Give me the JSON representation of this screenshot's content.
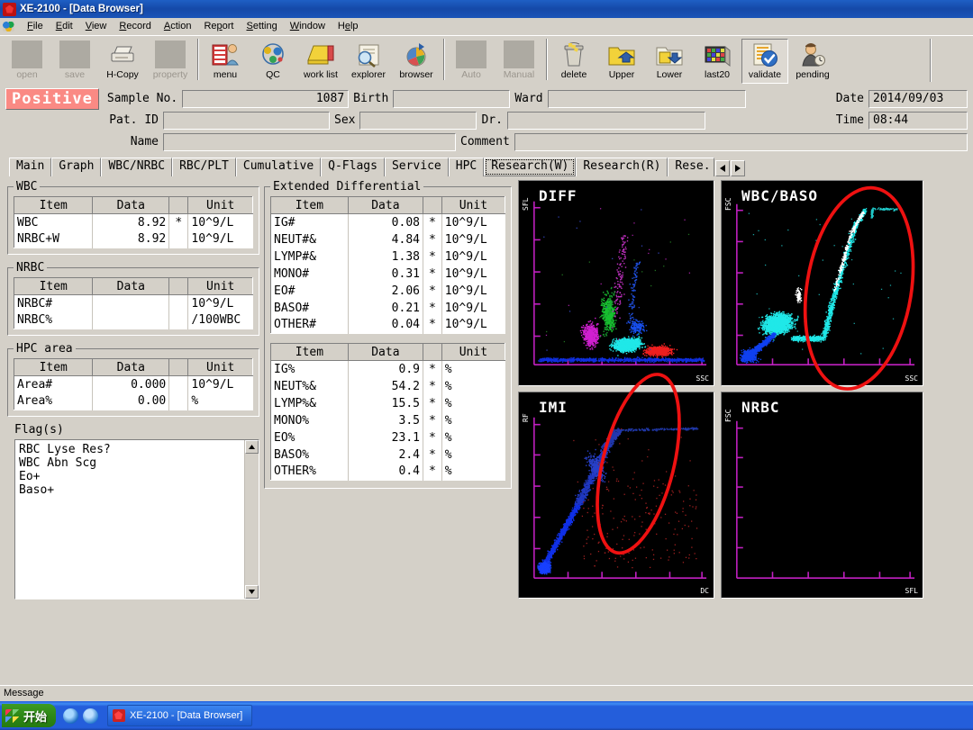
{
  "window": {
    "title": "XE-2100 - [Data Browser]",
    "app_icon": "app-icon"
  },
  "menubar": {
    "items": [
      {
        "label": "File"
      },
      {
        "label": "Edit"
      },
      {
        "label": "View"
      },
      {
        "label": "Record"
      },
      {
        "label": "Action"
      },
      {
        "label": "Report"
      },
      {
        "label": "Setting"
      },
      {
        "label": "Window"
      },
      {
        "label": "Help"
      }
    ]
  },
  "toolbar": {
    "buttons": [
      {
        "label": "open",
        "icon": "open-icon",
        "state": "disabled"
      },
      {
        "label": "save",
        "icon": "save-icon",
        "state": "disabled"
      },
      {
        "label": "H-Copy",
        "icon": "printer-icon",
        "state": "enabled"
      },
      {
        "label": "property",
        "icon": "property-icon",
        "state": "disabled"
      },
      {
        "label": "menu",
        "icon": "menu-icon",
        "state": "enabled"
      },
      {
        "label": "QC",
        "icon": "qc-icon",
        "state": "enabled"
      },
      {
        "label": "work list",
        "icon": "worklist-icon",
        "state": "enabled"
      },
      {
        "label": "explorer",
        "icon": "explorer-icon",
        "state": "enabled"
      },
      {
        "label": "browser",
        "icon": "browser-icon",
        "state": "enabled"
      },
      {
        "label": "Auto",
        "icon": "auto-icon",
        "state": "disabled"
      },
      {
        "label": "Manual",
        "icon": "manual-icon",
        "state": "disabled"
      },
      {
        "label": "delete",
        "icon": "trash-icon",
        "state": "enabled"
      },
      {
        "label": "Upper",
        "icon": "folder-up-icon",
        "state": "enabled"
      },
      {
        "label": "Lower",
        "icon": "folder-down-icon",
        "state": "enabled"
      },
      {
        "label": "last20",
        "icon": "last20-icon",
        "state": "enabled"
      },
      {
        "label": "validate",
        "icon": "validate-icon",
        "state": "pressed"
      },
      {
        "label": "pending",
        "icon": "pending-icon",
        "state": "enabled"
      }
    ]
  },
  "header": {
    "status_badge": "Positive",
    "status_badge_color": "#fa8a84",
    "fields": {
      "sample_no_label": "Sample No.",
      "sample_no_value": "1087",
      "birth_label": "Birth",
      "birth_value": "",
      "ward_label": "Ward",
      "ward_value": "",
      "date_label": "Date",
      "date_value": "2014/09/03",
      "patid_label": "Pat. ID",
      "patid_value": "",
      "sex_label": "Sex",
      "sex_value": "",
      "dr_label": "Dr.",
      "dr_value": "",
      "time_label": "Time",
      "time_value": "08:44",
      "name_label": "Name",
      "name_value": "",
      "comment_label": "Comment",
      "comment_value": ""
    }
  },
  "tabs": {
    "items": [
      {
        "label": "Main",
        "selected": false
      },
      {
        "label": "Graph",
        "selected": false
      },
      {
        "label": "WBC/NRBC",
        "selected": false
      },
      {
        "label": "RBC/PLT",
        "selected": false
      },
      {
        "label": "Cumulative",
        "selected": false
      },
      {
        "label": "Q-Flags",
        "selected": false
      },
      {
        "label": "Service",
        "selected": false
      },
      {
        "label": "HPC",
        "selected": false
      },
      {
        "label": "Research(W)",
        "selected": true
      },
      {
        "label": "Research(R)",
        "selected": false
      },
      {
        "label": "Rese.",
        "selected": false
      }
    ]
  },
  "panels": {
    "wbc": {
      "title": "WBC",
      "columns": [
        "Item",
        "Data",
        "",
        "Unit"
      ],
      "rows": [
        {
          "item": "WBC",
          "data": "8.92",
          "flag": "*",
          "unit": "10^9/L"
        },
        {
          "item": "NRBC+W",
          "data": "8.92",
          "flag": "",
          "unit": "10^9/L"
        }
      ]
    },
    "nrbc": {
      "title": "NRBC",
      "columns": [
        "Item",
        "Data",
        "",
        "Unit"
      ],
      "rows": [
        {
          "item": "NRBC#",
          "data": "",
          "flag": "",
          "unit": "10^9/L"
        },
        {
          "item": "NRBC%",
          "data": "",
          "flag": "",
          "unit": "/100WBC"
        }
      ]
    },
    "hpc": {
      "title": "HPC area",
      "columns": [
        "Item",
        "Data",
        "",
        "Unit"
      ],
      "rows": [
        {
          "item": "Area#",
          "data": "0.000",
          "flag": "",
          "unit": "10^9/L"
        },
        {
          "item": "Area%",
          "data": "0.00",
          "flag": "",
          "unit": "%"
        }
      ]
    },
    "flags": {
      "title": "Flag(s)",
      "items": [
        "RBC Lyse Res?",
        "WBC Abn Scg",
        "Eo+",
        "Baso+"
      ]
    },
    "extended_differential": {
      "title": "Extended Differential",
      "columns": [
        "Item",
        "Data",
        "",
        "Unit"
      ],
      "absolute_rows": [
        {
          "item": "IG#",
          "data": "0.08",
          "flag": "*",
          "unit": "10^9/L"
        },
        {
          "item": "NEUT#&",
          "data": "4.84",
          "flag": "*",
          "unit": "10^9/L"
        },
        {
          "item": "LYMP#&",
          "data": "1.38",
          "flag": "*",
          "unit": "10^9/L"
        },
        {
          "item": "MONO#",
          "data": "0.31",
          "flag": "*",
          "unit": "10^9/L"
        },
        {
          "item": "EO#",
          "data": "2.06",
          "flag": "*",
          "unit": "10^9/L"
        },
        {
          "item": "BASO#",
          "data": "0.21",
          "flag": "*",
          "unit": "10^9/L"
        },
        {
          "item": "OTHER#",
          "data": "0.04",
          "flag": "*",
          "unit": "10^9/L"
        }
      ],
      "percent_rows": [
        {
          "item": "IG%",
          "data": "0.9",
          "flag": "*",
          "unit": "%"
        },
        {
          "item": "NEUT%&",
          "data": "54.2",
          "flag": "*",
          "unit": "%"
        },
        {
          "item": "LYMP%&",
          "data": "15.5",
          "flag": "*",
          "unit": "%"
        },
        {
          "item": "MONO%",
          "data": "3.5",
          "flag": "*",
          "unit": "%"
        },
        {
          "item": "EO%",
          "data": "23.1",
          "flag": "*",
          "unit": "%"
        },
        {
          "item": "BASO%",
          "data": "2.4",
          "flag": "*",
          "unit": "%"
        },
        {
          "item": "OTHER%",
          "data": "0.4",
          "flag": "*",
          "unit": "%"
        }
      ]
    }
  },
  "scattergrams": [
    {
      "title": "DIFF",
      "ylabel": "SFL",
      "xlabel": "SSC",
      "empty": false
    },
    {
      "title": "WBC/BASO",
      "ylabel": "FSC",
      "xlabel": "SSC",
      "empty": false
    },
    {
      "title": "IMI",
      "ylabel": "RF",
      "xlabel": "DC",
      "empty": false
    },
    {
      "title": "NRBC",
      "ylabel": "FSC",
      "xlabel": "SFL",
      "empty": true
    }
  ],
  "annotations": {
    "ellipse_color": "#ee1111",
    "ellipses": [
      "wbc-baso-highlight",
      "diff-imi-highlight"
    ]
  },
  "statusbar": {
    "message_label": "Message",
    "message_text": ""
  },
  "taskbar": {
    "start_label": "开始",
    "quicklaunch": [
      "internet-explorer-icon",
      "show-desktop-icon"
    ],
    "tasks": [
      {
        "label": "XE-2100 - [Data Browser]",
        "icon": "app-icon"
      }
    ]
  }
}
